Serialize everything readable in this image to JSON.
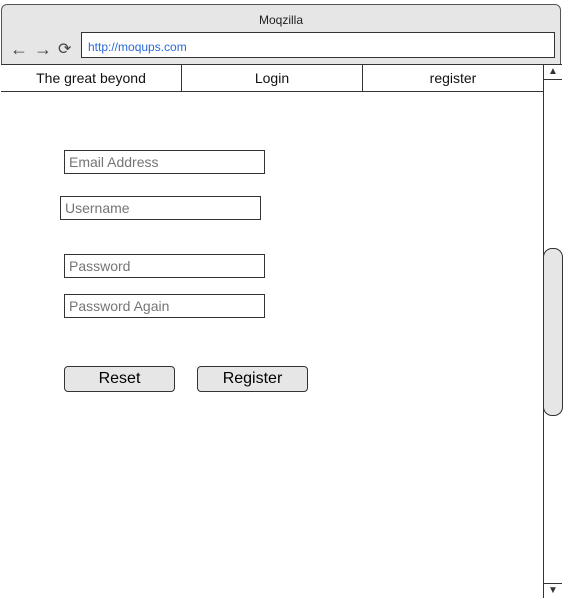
{
  "window": {
    "title": "Moqzilla",
    "url": "http://moqups.com"
  },
  "nav": {
    "tabs": [
      "The great beyond",
      "Login",
      "register"
    ]
  },
  "form": {
    "email_placeholder": "Email Address",
    "username_placeholder": "Username",
    "password_placeholder": "Password",
    "password_again_placeholder": "Password Again",
    "reset_label": "Reset",
    "register_label": "Register"
  },
  "colors": {
    "chrome": "#e6e6e6",
    "url": "#2a6ad8"
  }
}
